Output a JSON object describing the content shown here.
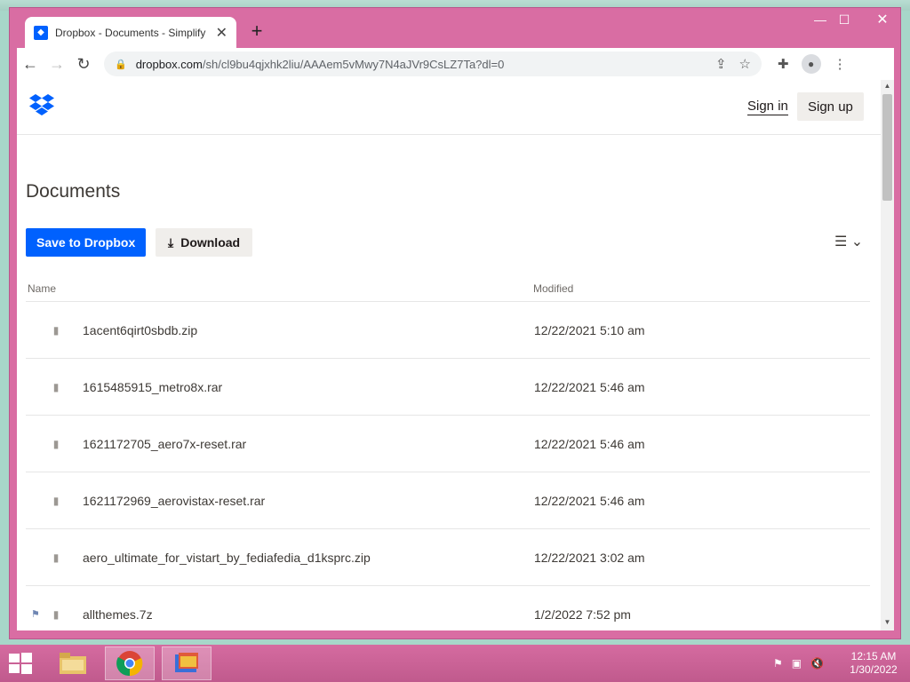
{
  "browser": {
    "tab_title": "Dropbox - Documents - Simplify",
    "tab_close": "✕",
    "new_tab": "+",
    "url_domain": "dropbox.com",
    "url_path": "/sh/cl9bu4qjxhk2liu/AAAem5vMwy7N4aJVr9CsLZ7Ta?dl=0"
  },
  "window_controls": {
    "minimize": "—",
    "maximize": "☐",
    "close": "✕"
  },
  "header": {
    "sign_in": "Sign in",
    "sign_up": "Sign up"
  },
  "folder": {
    "title": "Documents"
  },
  "actions": {
    "save_label": "Save to Dropbox",
    "download_label": "Download",
    "download_icon": "⤓"
  },
  "table": {
    "columns": {
      "name": "Name",
      "modified": "Modified"
    },
    "rows": [
      {
        "name": "1acent6qirt0sbdb.zip",
        "modified": "12/22/2021 5:10 am"
      },
      {
        "name": "1615485915_metro8x.rar",
        "modified": "12/22/2021 5:46 am"
      },
      {
        "name": "1621172705_aero7x-reset.rar",
        "modified": "12/22/2021 5:46 am"
      },
      {
        "name": "1621172969_aerovistax-reset.rar",
        "modified": "12/22/2021 5:46 am"
      },
      {
        "name": "aero_ultimate_for_vistart_by_fediafedia_d1ksprc.zip",
        "modified": "12/22/2021 3:02 am"
      },
      {
        "name": "allthemes.7z",
        "modified": "1/2/2022 7:52 pm"
      }
    ]
  },
  "taskbar": {
    "time": "12:15 AM",
    "date": "1/30/2022"
  },
  "colors": {
    "dropbox_blue": "#0061fe",
    "window_frame": "#d96da3",
    "taskbar": "#c05a8d"
  }
}
